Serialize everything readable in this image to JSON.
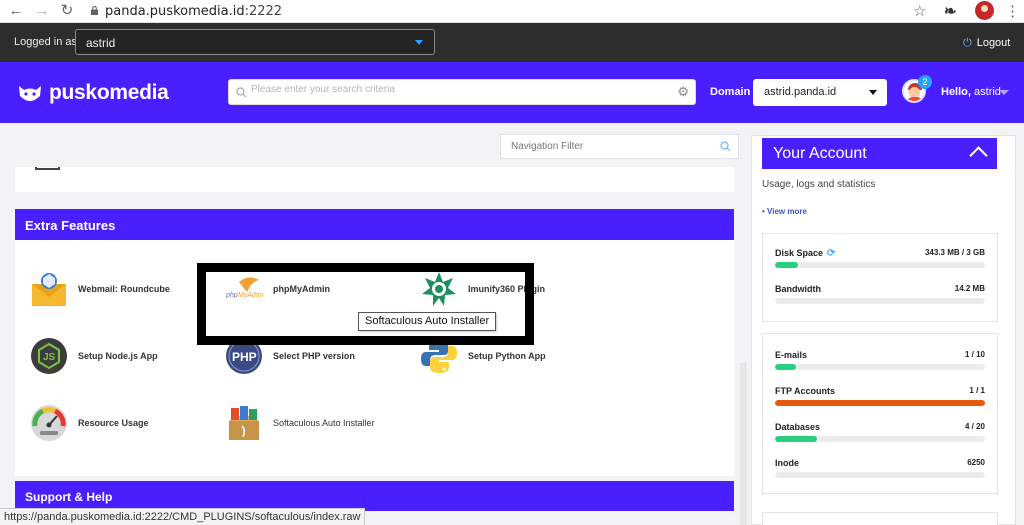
{
  "browser": {
    "url_host": "panda.puskomedia.id",
    "url_port": ":2222",
    "status_url": "https://panda.puskomedia.id:2222/CMD_PLUGINS/softaculous/index.raw"
  },
  "loginbar": {
    "label": "Logged in as",
    "user": "astrid",
    "logout": "Logout"
  },
  "header": {
    "brand": "puskomedia",
    "search_placeholder": "Please enter your search criteria",
    "domain_label": "Domain",
    "domain_value": "astrid.panda.id",
    "notification_count": "2",
    "hello_prefix": "Hello,",
    "hello_user": "astrid"
  },
  "nav_filter": {
    "placeholder": "Navigation Filter"
  },
  "extra_features": {
    "title": "Extra Features",
    "items": [
      {
        "label": "Webmail: Roundcube",
        "icon": "roundcube-icon"
      },
      {
        "label": "phpMyAdmin",
        "icon": "phpmyadmin-icon"
      },
      {
        "label": "Imunify360 Plugin",
        "icon": "imunify360-icon"
      },
      {
        "label": "Setup Node.js App",
        "icon": "nodejs-icon"
      },
      {
        "label": "Select PHP version",
        "icon": "php-icon"
      },
      {
        "label": "Setup Python App",
        "icon": "python-icon"
      },
      {
        "label": "Resource Usage",
        "icon": "gauge-icon"
      },
      {
        "label": "Softaculous Auto Installer",
        "icon": "softaculous-icon"
      }
    ],
    "tooltip": "Softaculous Auto Installer"
  },
  "support": {
    "title": "Support & Help"
  },
  "account": {
    "title": "Your Account",
    "subtitle": "Usage, logs and statistics",
    "view_more": "• View more",
    "group1": [
      {
        "name": "Disk Space",
        "value": "343.3 MB / 3 GB",
        "fill": 0.11,
        "color": "#27d07f"
      },
      {
        "name": "Bandwidth",
        "value": "14.2 MB",
        "fill": 0.0,
        "color": "#27d07f"
      }
    ],
    "group2": [
      {
        "name": "E-mails",
        "value": "1 / 10",
        "fill": 0.1,
        "color": "#27d07f"
      },
      {
        "name": "FTP Accounts",
        "value": "1 / 1",
        "fill": 1.0,
        "color": "#e8590c"
      },
      {
        "name": "Databases",
        "value": "4 / 20",
        "fill": 0.2,
        "color": "#27d07f"
      },
      {
        "name": "Inode",
        "value": "6250",
        "fill": 0.0,
        "color": "#27d07f"
      }
    ]
  }
}
